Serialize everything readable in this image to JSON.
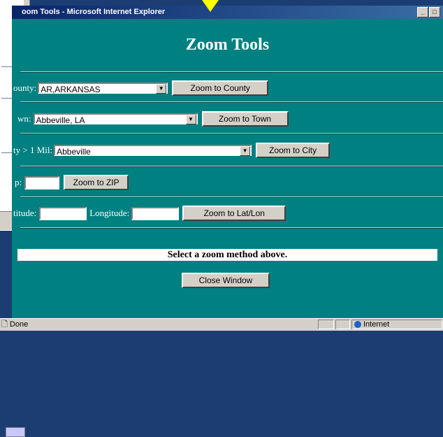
{
  "window": {
    "title": "oom Tools - Microsoft Internet Explorer"
  },
  "page": {
    "heading": "Zoom Tools",
    "county": {
      "label": "ounty:",
      "selected": "AR,ARKANSAS",
      "button": "Zoom to County"
    },
    "town": {
      "label": "wn:",
      "selected": "Abbeville, LA",
      "button": "Zoom to Town"
    },
    "city": {
      "label": "ty > 1 Mil:",
      "selected": "Abbeville",
      "button": "Zoom to City"
    },
    "zip": {
      "label": "p:",
      "value": "",
      "button": "Zoom to ZIP"
    },
    "latlon": {
      "lat_label": "titude:",
      "lon_label": "Longitude:",
      "lat_value": "",
      "lon_value": "",
      "button": "Zoom to Lat/Lon"
    },
    "message": "Select a zoom method above.",
    "close_button": "Close Window"
  },
  "statusbar": {
    "status": "Done",
    "zone": "Internet"
  },
  "colors": {
    "page_bg": "#008080",
    "titlebar": "#0a246a",
    "chrome": "#d4d0c8"
  }
}
